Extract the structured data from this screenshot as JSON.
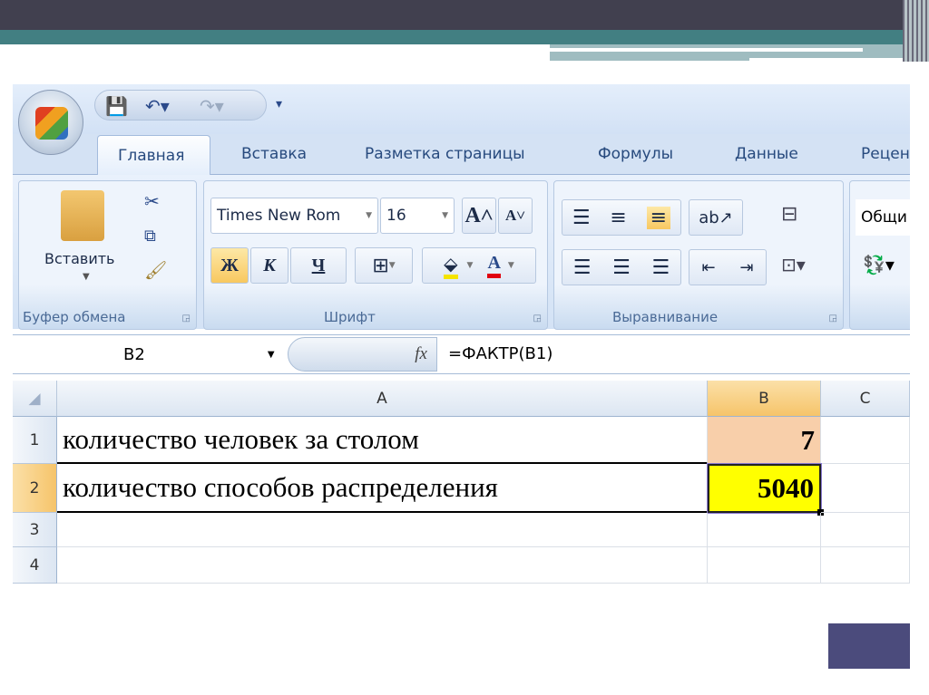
{
  "qat": {
    "save_icon": "save-icon",
    "undo_icon": "undo-icon",
    "redo_icon": "redo-icon",
    "customize_icon": "customize-icon"
  },
  "tabs": [
    "Главная",
    "Вставка",
    "Разметка страницы",
    "Формулы",
    "Данные",
    "Рецен"
  ],
  "clipboard": {
    "paste_label": "Вставить",
    "group_label": "Буфер обмена"
  },
  "font": {
    "name": "Times New Rom",
    "size": "16",
    "bold": "Ж",
    "italic": "К",
    "underline": "Ч",
    "grow": "A",
    "shrink": "A",
    "group_label": "Шрифт",
    "fill_color": "#f5e400",
    "font_color": "#e00010"
  },
  "alignment": {
    "group_label": "Выравнивание"
  },
  "number": {
    "format": "Общи"
  },
  "formula_bar": {
    "name_box": "B2",
    "fx": "fx",
    "formula": "=ФАКТР(B1)"
  },
  "sheet": {
    "columns": [
      "A",
      "B",
      "C"
    ],
    "rows": [
      {
        "num": "1",
        "a": "количество человек за столом",
        "b": "7"
      },
      {
        "num": "2",
        "a": "количество способов распределения",
        "b": "5040"
      },
      {
        "num": "3",
        "a": "",
        "b": ""
      },
      {
        "num": "4",
        "a": "",
        "b": ""
      }
    ]
  },
  "colors": {
    "header_dark": "#41404f",
    "teal": "#427f82",
    "b1_fill": "#f8cfaa",
    "b2_fill": "#ffff00",
    "accent_square": "#4b4b7c"
  }
}
